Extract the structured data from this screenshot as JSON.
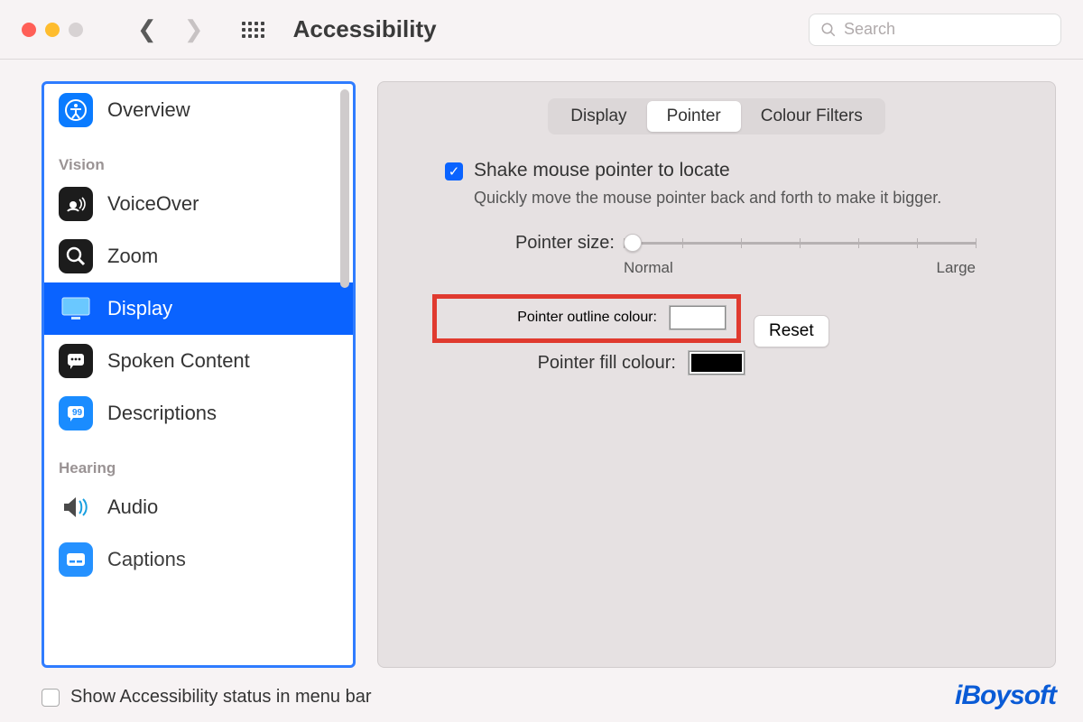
{
  "titlebar": {
    "title": "Accessibility",
    "search_placeholder": "Search"
  },
  "sidebar": {
    "top_item": "Overview",
    "group_vision": "Vision",
    "items_vision": [
      "VoiceOver",
      "Zoom",
      "Display",
      "Spoken Content",
      "Descriptions"
    ],
    "group_hearing": "Hearing",
    "items_hearing": [
      "Audio",
      "Captions"
    ],
    "selected": "Display"
  },
  "tabs": {
    "display": "Display",
    "pointer": "Pointer",
    "colour": "Colour Filters",
    "active": "Pointer"
  },
  "pointer": {
    "shake_label": "Shake mouse pointer to locate",
    "shake_sub": "Quickly move the mouse pointer back and forth to make it bigger.",
    "size_label": "Pointer size:",
    "size_min": "Normal",
    "size_max": "Large",
    "outline_label": "Pointer outline colour:",
    "fill_label": "Pointer fill colour:",
    "reset": "Reset",
    "outline_value": "#ffffff",
    "fill_value": "#000000"
  },
  "footer": {
    "label": "Show Accessibility status in menu bar",
    "checked": false
  },
  "watermark": "iBoysoft"
}
